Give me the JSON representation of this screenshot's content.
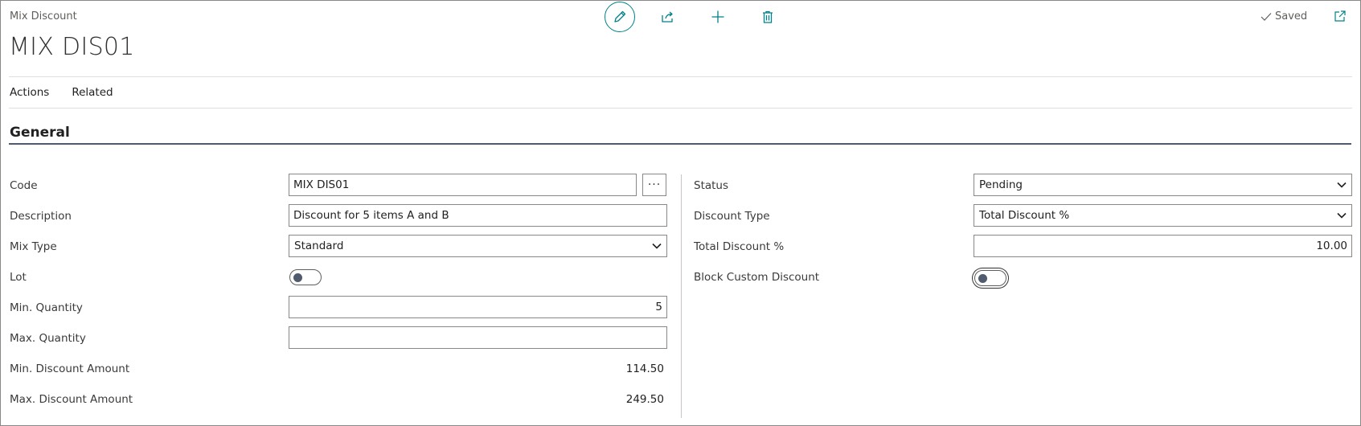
{
  "header": {
    "caption": "Mix Discount",
    "record_title": "MIX DIS01",
    "saved_label": "Saved"
  },
  "toolbar": {
    "icons": [
      "pencil-icon",
      "share-icon",
      "plus-icon",
      "trash-icon"
    ]
  },
  "menu": {
    "actions": "Actions",
    "related": "Related"
  },
  "section": {
    "title": "General"
  },
  "left": {
    "code": {
      "label": "Code",
      "value": "MIX DIS01",
      "lookup": "···"
    },
    "description": {
      "label": "Description",
      "value": "Discount for 5 items A and B"
    },
    "mix_type": {
      "label": "Mix Type",
      "value": "Standard"
    },
    "lot": {
      "label": "Lot",
      "on": false
    },
    "min_quantity": {
      "label": "Min. Quantity",
      "value": "5"
    },
    "max_quantity": {
      "label": "Max. Quantity",
      "value": ""
    },
    "min_discount_amount": {
      "label": "Min. Discount Amount",
      "value": "114.50"
    },
    "max_discount_amount": {
      "label": "Max. Discount Amount",
      "value": "249.50"
    }
  },
  "right": {
    "status": {
      "label": "Status",
      "value": "Pending"
    },
    "discount_type": {
      "label": "Discount Type",
      "value": "Total Discount %"
    },
    "total_discount_pct": {
      "label": "Total Discount %",
      "value": "10.00"
    },
    "block_custom_discount": {
      "label": "Block Custom Discount",
      "on": false
    }
  },
  "colors": {
    "accent": "#00818a",
    "section_underline": "#505c6d",
    "border": "#8a8886"
  }
}
